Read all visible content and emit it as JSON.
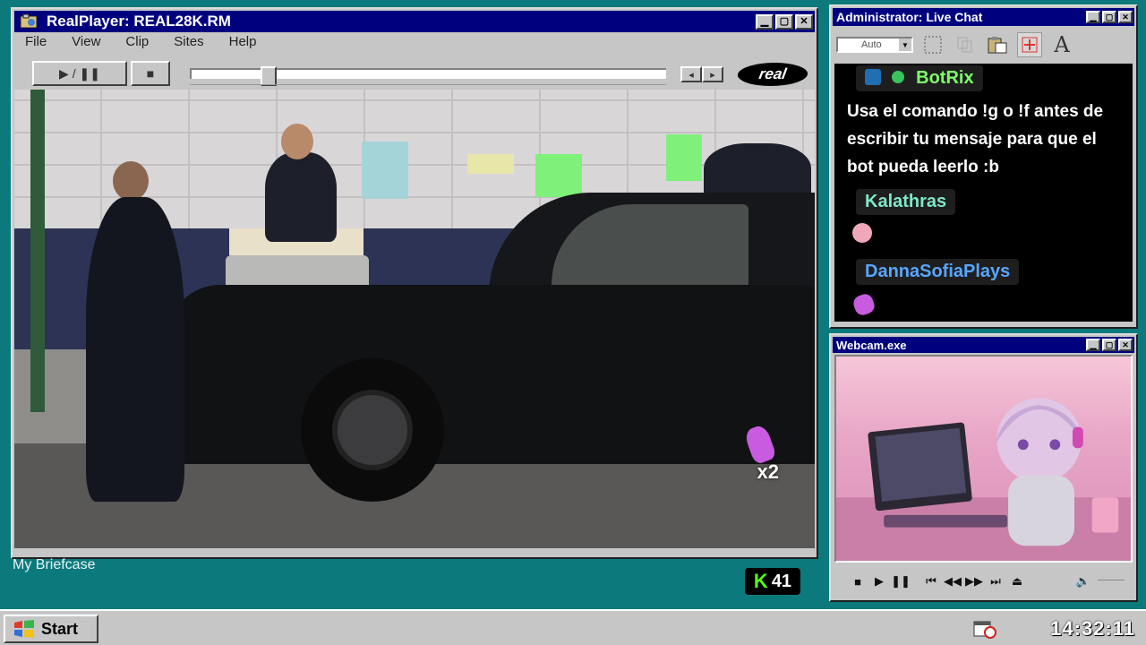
{
  "player": {
    "title": "RealPlayer: REAL28K.RM",
    "menu": [
      "File",
      "View",
      "Clip",
      "Sites",
      "Help"
    ],
    "play_pause_label": "▶ / ❚❚",
    "stop_label": "■",
    "seek_back_label": "◂",
    "seek_fwd_label": "▸",
    "logo_text": "real",
    "seek_progress": 0.15,
    "overlay_emote_count": "x2"
  },
  "chat": {
    "title": "Administrator: Live Chat",
    "font_select_value": "Auto",
    "toolbar_icons": [
      "select-icon",
      "copy-icon",
      "paste-icon",
      "target-icon",
      "font-icon"
    ],
    "font_button_label": "A",
    "messages": [
      {
        "user": "BotRix",
        "user_color": "#7fff6a",
        "text": "Usa el comando !g o !f antes de escribir tu mensaje para que el bot pueda leerlo :b"
      },
      {
        "user": "Kalathras",
        "user_color": "#7ee8c8",
        "text": ""
      },
      {
        "user": "DannaSofiaPlays",
        "user_color": "#58a6ff",
        "text": ""
      }
    ]
  },
  "webcam": {
    "title": "Webcam.exe",
    "controls": [
      "■",
      "▶",
      "❚❚",
      "⏮",
      "◀◀",
      "▶▶",
      "⏭",
      "⏏",
      "🔈"
    ]
  },
  "desktop": {
    "icon_label": "My Briefcase",
    "kick_badge_letter": "K",
    "kick_badge_count": "41"
  },
  "taskbar": {
    "start_label": "Start",
    "clock": "14:32:11"
  },
  "colors": {
    "desktop": "#0c7a7c",
    "titlebar": "#00007f",
    "kick_green": "#53fc18"
  }
}
